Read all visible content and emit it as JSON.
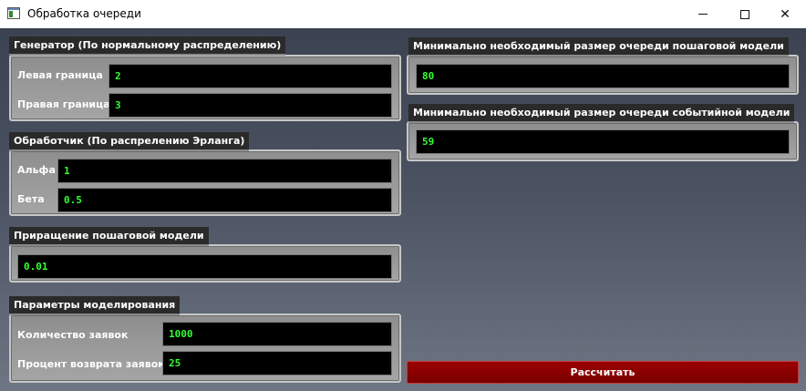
{
  "window": {
    "title": "Обработка очереди",
    "minimize_glyph": "—",
    "maximize_glyph": "☐",
    "close_glyph": "✕"
  },
  "generator": {
    "title": "Генератор (По нормальному распределению)",
    "left_label": "Левая граница",
    "left_value": "2",
    "right_label": "Правая граница",
    "right_value": "3"
  },
  "handler": {
    "title": "Обработчик (По распрелению Эрланга)",
    "alpha_label": "Альфа",
    "alpha_value": "1",
    "beta_label": "Бета",
    "beta_value": "0.5"
  },
  "step": {
    "title": "Приращение пошаговой модели",
    "value": "0.01"
  },
  "params": {
    "title": "Параметры моделирования",
    "count_label": "Количество заявок",
    "count_value": "1000",
    "return_label": "Процент возврата заявок",
    "return_value": "25"
  },
  "result_step": {
    "title": "Минимально необходимый размер очереди  пошаговой модели",
    "value": "80"
  },
  "result_event": {
    "title": "Минимально необходимый размер очереди  событийной модели",
    "value": "59"
  },
  "calculate_label": "Рассчитать",
  "colors": {
    "field_text": "#33ff33",
    "button_bg": "#8b0000",
    "group_bg": "#9a9a9a"
  }
}
